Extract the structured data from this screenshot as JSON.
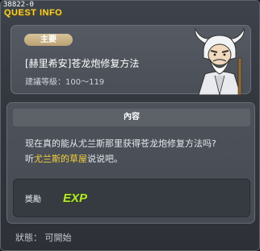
{
  "window": {
    "quest_id": "38822-0",
    "title": "QUEST INFO"
  },
  "quest": {
    "badge": "主要",
    "title": "[赫里希安]苍龙炮修复方法",
    "level": "建議等級：100～119"
  },
  "content": {
    "header": "內容",
    "line1": "现在真的能从尤兰斯那里获得苍龙炮修复方法吗?",
    "line2_prefix": "听",
    "npc_name": "尤兰斯的草屋",
    "line2_suffix": "说说吧。"
  },
  "reward": {
    "label": "獎勵",
    "exp_text": "EXP"
  },
  "status": {
    "text": "狀態： 可開始"
  },
  "colors": {
    "title_yellow": "#f4d23c",
    "badge_tan": "#c9b080",
    "npc_link": "#f6d23c",
    "exp_green": "#b6e63a"
  }
}
